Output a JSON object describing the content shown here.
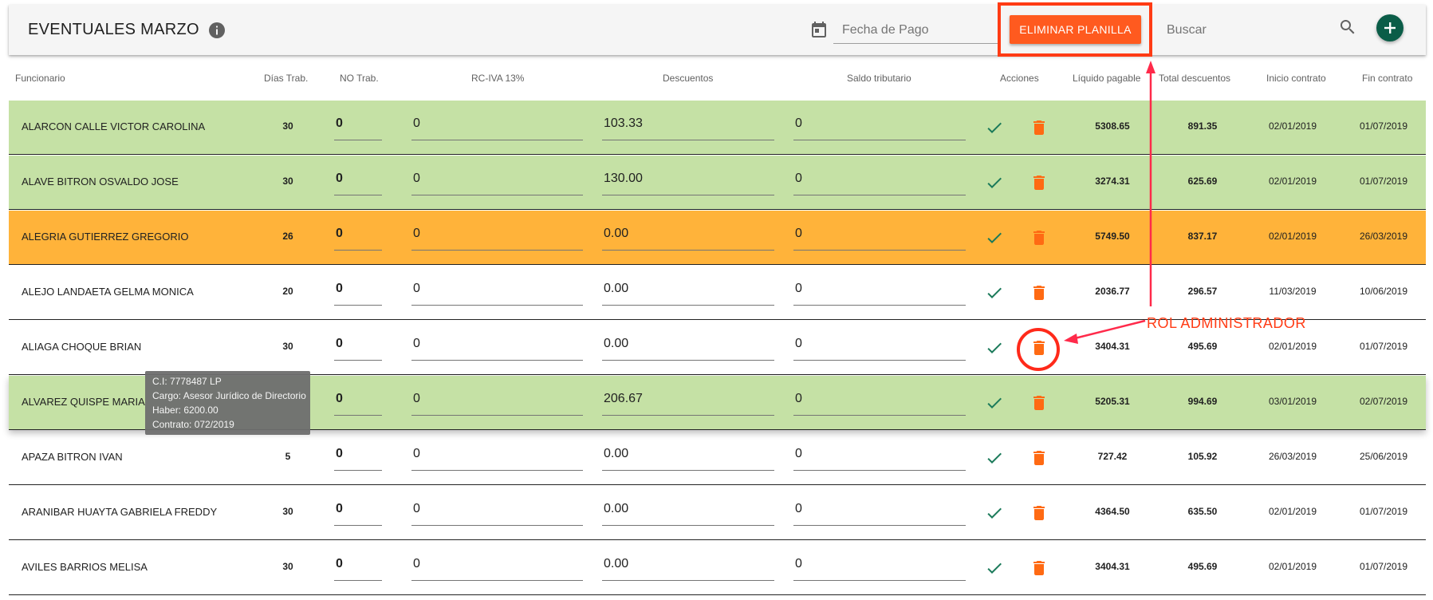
{
  "toolbar": {
    "title": "EVENTUALES MARZO",
    "date_placeholder": "Fecha de Pago",
    "delete_label": "ELIMINAR PLANILLA",
    "search_placeholder": "Buscar"
  },
  "columns": {
    "funcionario": "Funcionario",
    "dias": "Días Trab.",
    "notrab": "NO Trab.",
    "rciva": "RC-IVA 13%",
    "descuentos": "Descuentos",
    "saldo": "Saldo tributario",
    "acciones": "Acciones",
    "liquido": "Líquido pagable",
    "total_desc": "Total descuentos",
    "inicio": "Inicio contrato",
    "fin": "Fin contrato"
  },
  "rows": [
    {
      "name": "ALARCON CALLE VICTOR CAROLINA",
      "dias": "30",
      "notrab": "0",
      "rciva": "0",
      "descuentos": "103.33",
      "saldo": "0",
      "liquido": "5308.65",
      "total_desc": "891.35",
      "inicio": "02/01/2019",
      "fin": "01/07/2019",
      "status": "green"
    },
    {
      "name": "ALAVE BITRON OSVALDO JOSE",
      "dias": "30",
      "notrab": "0",
      "rciva": "0",
      "descuentos": "130.00",
      "saldo": "0",
      "liquido": "3274.31",
      "total_desc": "625.69",
      "inicio": "02/01/2019",
      "fin": "01/07/2019",
      "status": "green"
    },
    {
      "name": "ALEGRIA GUTIERREZ GREGORIO",
      "dias": "26",
      "notrab": "0",
      "rciva": "0",
      "descuentos": "0.00",
      "saldo": "0",
      "liquido": "5749.50",
      "total_desc": "837.17",
      "inicio": "02/01/2019",
      "fin": "26/03/2019",
      "status": "orange"
    },
    {
      "name": "ALEJO LANDAETA GELMA MONICA",
      "dias": "20",
      "notrab": "0",
      "rciva": "0",
      "descuentos": "0.00",
      "saldo": "0",
      "liquido": "2036.77",
      "total_desc": "296.57",
      "inicio": "11/03/2019",
      "fin": "10/06/2019",
      "status": "white"
    },
    {
      "name": "ALIAGA CHOQUE BRIAN",
      "dias": "30",
      "notrab": "0",
      "rciva": "0",
      "descuentos": "0.00",
      "saldo": "0",
      "liquido": "3404.31",
      "total_desc": "495.69",
      "inicio": "02/01/2019",
      "fin": "01/07/2019",
      "status": "white"
    },
    {
      "name": "ALVAREZ QUISPE MARIA",
      "dias": "",
      "notrab": "0",
      "rciva": "0",
      "descuentos": "206.67",
      "saldo": "0",
      "liquido": "5205.31",
      "total_desc": "994.69",
      "inicio": "03/01/2019",
      "fin": "02/07/2019",
      "status": "green"
    },
    {
      "name": "APAZA BITRON IVAN",
      "dias": "5",
      "notrab": "0",
      "rciva": "0",
      "descuentos": "0.00",
      "saldo": "0",
      "liquido": "727.42",
      "total_desc": "105.92",
      "inicio": "26/03/2019",
      "fin": "25/06/2019",
      "status": "white"
    },
    {
      "name": "ARANIBAR HUAYTA GABRIELA FREDDY",
      "dias": "30",
      "notrab": "0",
      "rciva": "0",
      "descuentos": "0.00",
      "saldo": "0",
      "liquido": "4364.50",
      "total_desc": "635.50",
      "inicio": "02/01/2019",
      "fin": "01/07/2019",
      "status": "white"
    },
    {
      "name": "AVILES BARRIOS MELISA",
      "dias": "30",
      "notrab": "0",
      "rciva": "0",
      "descuentos": "0.00",
      "saldo": "0",
      "liquido": "3404.31",
      "total_desc": "495.69",
      "inicio": "02/01/2019",
      "fin": "01/07/2019",
      "status": "white"
    }
  ],
  "tooltip": {
    "ci": "C.I: 7778487 LP",
    "cargo": "Cargo: Asesor Jurídico de Directorio",
    "haber": "Haber: 6200.00",
    "contrato": "Contrato: 072/2019"
  },
  "annotation": {
    "label": "ROL ADMINISTRADOR"
  },
  "colors": {
    "accent": "#ff5a1f",
    "row_green": "#c5e1a5",
    "row_orange": "#ffb33a",
    "fab": "#0b5d48",
    "check": "#1b7a5a",
    "annotation": "#ff3b14"
  },
  "icons": [
    "info-icon",
    "calendar-icon",
    "search-icon",
    "add-icon",
    "check-icon",
    "trash-icon"
  ]
}
